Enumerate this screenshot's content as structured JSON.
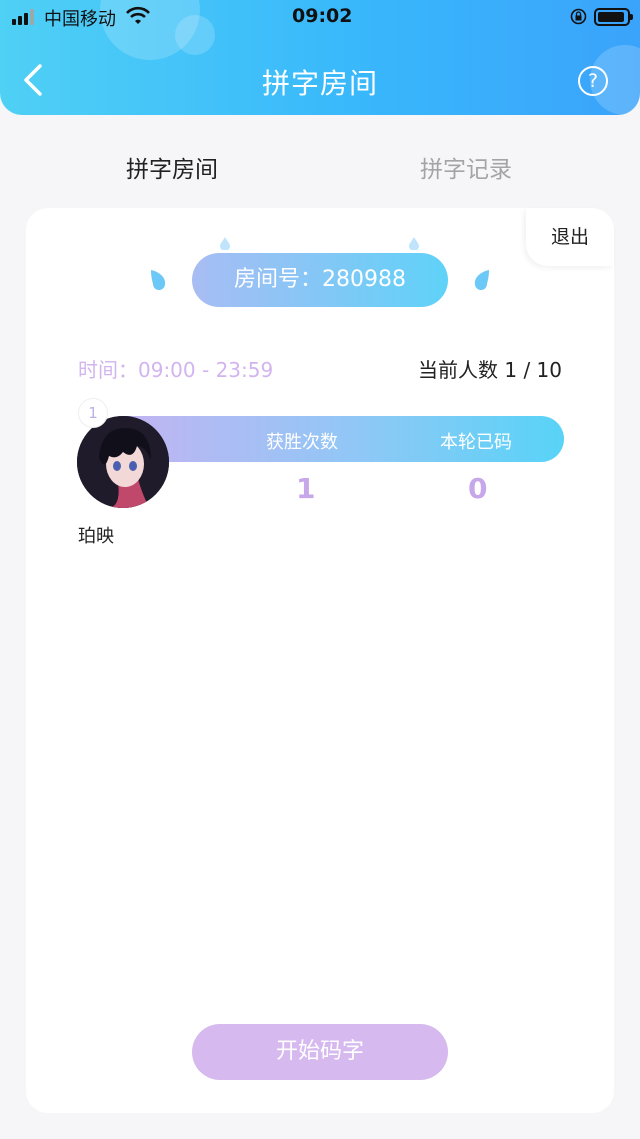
{
  "status_bar": {
    "carrier": "中国移动",
    "time": "09:02"
  },
  "nav": {
    "title": "拼字房间",
    "help_label": "?"
  },
  "tabs": [
    {
      "label": "拼字房间",
      "active": true
    },
    {
      "label": "拼字记录",
      "active": false
    }
  ],
  "room": {
    "exit_label": "退出",
    "room_number_text": "房间号：280988",
    "time_text": "时间：09:00 - 23:59",
    "count_text": "当前人数 1 / 10",
    "stats_headers": [
      "获胜次数",
      "本轮已码"
    ],
    "player": {
      "rank": "1",
      "name": "珀映",
      "wins": "1",
      "typed": "0"
    },
    "start_label": "开始码字"
  },
  "colors": {
    "header_gradient_start": "#4fd0f5",
    "header_gradient_end": "#3aa3fb",
    "accent_purple": "#d5b9ef",
    "stat_value": "#c6a7ea"
  }
}
